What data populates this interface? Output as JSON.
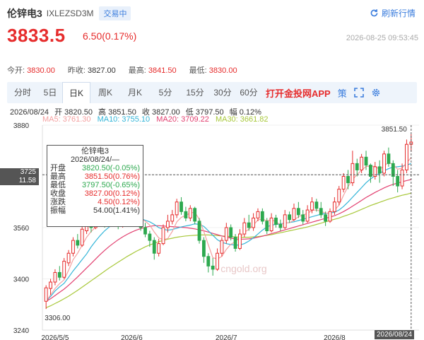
{
  "header": {
    "name": "伦锌电3",
    "code": "IXLEZSD3M",
    "status": "交易中",
    "refresh_label": "刷新行情"
  },
  "quote": {
    "price": "3833.5",
    "change": "6.50(0.17%)",
    "datetime": "2026-08-25 09:53:45",
    "open_label": "今开:",
    "open": "3830.00",
    "prev_close_label": "昨收:",
    "prev_close": "3827.00",
    "high_label": "最高:",
    "high": "3841.50",
    "low_label": "最低:",
    "low": "3830.00"
  },
  "tabs": [
    {
      "label": "分时"
    },
    {
      "label": "5日"
    },
    {
      "label": "日K"
    },
    {
      "label": "周K"
    },
    {
      "label": "月K"
    },
    {
      "label": "5分"
    },
    {
      "label": "15分"
    },
    {
      "label": "30分"
    },
    {
      "label": "60分"
    }
  ],
  "app_link": "打开金投网APP",
  "adjust_icon_label": "策",
  "ohlc": {
    "date": "2026/08/24",
    "open": "开 3820.50",
    "high": "高 3851.50",
    "close": "收 3827.00",
    "low": "低 3797.50",
    "amp": "幅 0.12%"
  },
  "ma": {
    "ma5": "MA5: 3761.30",
    "ma10": "MA10: 3755.10",
    "ma20": "MA20: 3709.22",
    "ma30": "MA30: 3661.82"
  },
  "tooltip": {
    "title": "伦锌电3",
    "date": "2026/08/24/—",
    "rows": [
      {
        "label": "开盘",
        "value": "3820.50(-0.05%)",
        "tone": "green"
      },
      {
        "label": "最高",
        "value": "3851.50(0.76%)",
        "tone": "red"
      },
      {
        "label": "最低",
        "value": "3797.50(-0.65%)",
        "tone": "green"
      },
      {
        "label": "收盘",
        "value": "3827.00(0.12%)",
        "tone": "red"
      },
      {
        "label": "涨跌",
        "value": "4.50(0.12%)",
        "tone": "red"
      },
      {
        "label": "振幅",
        "value": "54.00(1.41%)",
        "tone": "dark"
      }
    ]
  },
  "crosshair": {
    "price": "3725",
    "sub": "11.58"
  },
  "colors": {
    "up": "#e62c2c",
    "down": "#2da94f",
    "ma5": "#f4a0a0",
    "ma10": "#33b5d8",
    "ma20": "#e24070",
    "ma30": "#a8c83a",
    "accent": "#3b7ddd"
  },
  "chart_data": {
    "type": "candlestick",
    "y_ticks": [
      3880,
      3725,
      3560,
      3400,
      3240
    ],
    "ylim": [
      3240,
      3880
    ],
    "x_labels": [
      "2026/5/5",
      "2026/6",
      "2026/7",
      "2026/8",
      "2026/08/24"
    ],
    "annotations": {
      "max": "3851.50",
      "min": "3306.00"
    },
    "watermark": "cngold.org",
    "candles": [
      [
        3330,
        3372,
        3306,
        3380
      ],
      [
        3370,
        3390,
        3350,
        3400
      ],
      [
        3390,
        3420,
        3380,
        3430
      ],
      [
        3420,
        3405,
        3395,
        3440
      ],
      [
        3405,
        3455,
        3400,
        3465
      ],
      [
        3450,
        3480,
        3440,
        3490
      ],
      [
        3480,
        3520,
        3470,
        3530
      ],
      [
        3520,
        3505,
        3495,
        3540
      ],
      [
        3505,
        3555,
        3500,
        3565
      ],
      [
        3550,
        3585,
        3540,
        3600
      ],
      [
        3585,
        3560,
        3545,
        3595
      ],
      [
        3560,
        3600,
        3555,
        3610
      ],
      [
        3600,
        3585,
        3570,
        3615
      ],
      [
        3585,
        3575,
        3560,
        3600
      ],
      [
        3575,
        3610,
        3565,
        3625
      ],
      [
        3610,
        3590,
        3580,
        3630
      ],
      [
        3590,
        3570,
        3555,
        3605
      ],
      [
        3570,
        3600,
        3560,
        3615
      ],
      [
        3600,
        3580,
        3570,
        3620
      ],
      [
        3580,
        3620,
        3570,
        3630
      ],
      [
        3620,
        3595,
        3585,
        3640
      ],
      [
        3595,
        3560,
        3550,
        3605
      ],
      [
        3560,
        3540,
        3530,
        3575
      ],
      [
        3540,
        3520,
        3500,
        3550
      ],
      [
        3520,
        3480,
        3460,
        3530
      ],
      [
        3480,
        3510,
        3470,
        3525
      ],
      [
        3510,
        3560,
        3505,
        3570
      ],
      [
        3560,
        3580,
        3545,
        3600
      ],
      [
        3580,
        3600,
        3570,
        3615
      ],
      [
        3600,
        3640,
        3590,
        3650
      ],
      [
        3640,
        3610,
        3600,
        3655
      ],
      [
        3610,
        3590,
        3580,
        3625
      ],
      [
        3590,
        3620,
        3580,
        3630
      ],
      [
        3620,
        3580,
        3570,
        3625
      ],
      [
        3580,
        3520,
        3510,
        3590
      ],
      [
        3520,
        3470,
        3450,
        3530
      ],
      [
        3470,
        3440,
        3420,
        3480
      ],
      [
        3440,
        3430,
        3410,
        3465
      ],
      [
        3430,
        3480,
        3425,
        3495
      ],
      [
        3480,
        3520,
        3470,
        3530
      ],
      [
        3520,
        3560,
        3510,
        3575
      ],
      [
        3560,
        3530,
        3520,
        3570
      ],
      [
        3530,
        3495,
        3485,
        3540
      ],
      [
        3495,
        3540,
        3490,
        3555
      ],
      [
        3540,
        3575,
        3530,
        3590
      ],
      [
        3575,
        3560,
        3550,
        3600
      ],
      [
        3560,
        3590,
        3550,
        3605
      ],
      [
        3590,
        3610,
        3580,
        3620
      ],
      [
        3610,
        3580,
        3570,
        3620
      ],
      [
        3580,
        3550,
        3540,
        3590
      ],
      [
        3550,
        3590,
        3545,
        3605
      ],
      [
        3590,
        3570,
        3560,
        3600
      ],
      [
        3570,
        3560,
        3550,
        3585
      ],
      [
        3560,
        3600,
        3555,
        3615
      ],
      [
        3600,
        3585,
        3575,
        3610
      ],
      [
        3585,
        3620,
        3580,
        3635
      ],
      [
        3620,
        3600,
        3590,
        3640
      ],
      [
        3600,
        3580,
        3570,
        3615
      ],
      [
        3580,
        3615,
        3575,
        3630
      ],
      [
        3615,
        3640,
        3605,
        3655
      ],
      [
        3640,
        3620,
        3610,
        3650
      ],
      [
        3620,
        3600,
        3590,
        3640
      ],
      [
        3600,
        3580,
        3565,
        3610
      ],
      [
        3580,
        3610,
        3575,
        3620
      ],
      [
        3610,
        3640,
        3600,
        3655
      ],
      [
        3640,
        3680,
        3630,
        3690
      ],
      [
        3680,
        3720,
        3670,
        3730
      ],
      [
        3720,
        3700,
        3680,
        3740
      ],
      [
        3700,
        3760,
        3690,
        3800
      ],
      [
        3760,
        3740,
        3720,
        3775
      ],
      [
        3740,
        3780,
        3730,
        3790
      ],
      [
        3780,
        3755,
        3740,
        3800
      ],
      [
        3755,
        3720,
        3700,
        3760
      ],
      [
        3720,
        3750,
        3710,
        3765
      ],
      [
        3750,
        3730,
        3700,
        3770
      ],
      [
        3730,
        3790,
        3720,
        3800
      ],
      [
        3790,
        3760,
        3750,
        3810
      ],
      [
        3760,
        3720,
        3690,
        3770
      ],
      [
        3720,
        3690,
        3670,
        3740
      ],
      [
        3690,
        3740,
        3680,
        3760
      ],
      [
        3740,
        3820,
        3730,
        3835
      ],
      [
        3820,
        3827,
        3797.5,
        3851.5
      ]
    ],
    "ma5": [
      3330,
      3350,
      3370,
      3385,
      3397,
      3427,
      3460,
      3480,
      3505,
      3530,
      3548,
      3561,
      3578,
      3586,
      3586,
      3590,
      3586,
      3585,
      3588,
      3595,
      3592,
      3588,
      3580,
      3568,
      3546,
      3528,
      3522,
      3526,
      3548,
      3578,
      3592,
      3598,
      3606,
      3608,
      3586,
      3548,
      3506,
      3466,
      3462,
      3470,
      3492,
      3508,
      3516,
      3528,
      3545,
      3555,
      3568,
      3584,
      3587,
      3581,
      3585,
      3578,
      3569,
      3575,
      3575,
      3584,
      3594,
      3600,
      3604,
      3614,
      3615,
      3611,
      3605,
      3606,
      3615,
      3630,
      3661,
      3688,
      3710,
      3726,
      3739,
      3751,
      3752,
      3751,
      3742,
      3752,
      3764,
      3757,
      3742,
      3746,
      3763,
      3778
    ],
    "ma10": [
      3330,
      3345,
      3362,
      3375,
      3386,
      3405,
      3425,
      3442,
      3460,
      3478,
      3500,
      3518,
      3535,
      3550,
      3562,
      3572,
      3580,
      3585,
      3590,
      3592,
      3590,
      3588,
      3583,
      3578,
      3570,
      3560,
      3555,
      3552,
      3554,
      3558,
      3562,
      3565,
      3568,
      3572,
      3570,
      3564,
      3550,
      3536,
      3522,
      3514,
      3510,
      3507,
      3505,
      3506,
      3510,
      3518,
      3528,
      3540,
      3552,
      3562,
      3568,
      3570,
      3572,
      3574,
      3576,
      3578,
      3582,
      3586,
      3590,
      3594,
      3598,
      3602,
      3604,
      3606,
      3608,
      3615,
      3626,
      3640,
      3655,
      3670,
      3685,
      3700,
      3712,
      3722,
      3730,
      3737,
      3744,
      3749,
      3750,
      3752,
      3755,
      3760
    ],
    "ma20": [
      3330,
      3338,
      3348,
      3358,
      3368,
      3380,
      3393,
      3406,
      3420,
      3434,
      3448,
      3462,
      3476,
      3489,
      3501,
      3512,
      3522,
      3531,
      3539,
      3546,
      3552,
      3557,
      3561,
      3564,
      3566,
      3566,
      3565,
      3564,
      3563,
      3562,
      3561,
      3560,
      3558,
      3556,
      3553,
      3550,
      3546,
      3542,
      3538,
      3534,
      3530,
      3527,
      3525,
      3524,
      3524,
      3525,
      3527,
      3530,
      3533,
      3537,
      3541,
      3545,
      3549,
      3553,
      3557,
      3561,
      3565,
      3569,
      3573,
      3577,
      3581,
      3585,
      3589,
      3593,
      3597,
      3603,
      3610,
      3618,
      3627,
      3636,
      3645,
      3654,
      3662,
      3670,
      3677,
      3684,
      3690,
      3695,
      3699,
      3703,
      3707,
      3710
    ],
    "ma30": [
      3310,
      3316,
      3323,
      3330,
      3338,
      3346,
      3355,
      3364,
      3374,
      3384,
      3394,
      3404,
      3414,
      3424,
      3434,
      3443,
      3452,
      3461,
      3470,
      3478,
      3486,
      3493,
      3500,
      3506,
      3511,
      3516,
      3520,
      3524,
      3527,
      3530,
      3532,
      3534,
      3535,
      3536,
      3537,
      3537,
      3537,
      3536,
      3535,
      3534,
      3533,
      3532,
      3531,
      3530,
      3530,
      3530,
      3531,
      3532,
      3534,
      3536,
      3538,
      3541,
      3544,
      3547,
      3550,
      3553,
      3556,
      3559,
      3562,
      3566,
      3570,
      3574,
      3578,
      3582,
      3586,
      3590,
      3595,
      3600,
      3605,
      3611,
      3617,
      3623,
      3629,
      3634,
      3639,
      3644,
      3649,
      3653,
      3657,
      3661,
      3664,
      3668
    ]
  }
}
